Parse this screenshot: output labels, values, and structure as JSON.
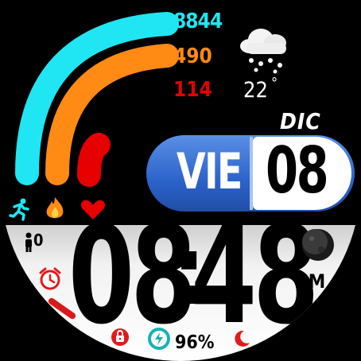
{
  "stats": {
    "steps": "8844",
    "calories": "490",
    "heart_rate": "114"
  },
  "weather": {
    "temperature": "22",
    "degree_symbol": "°"
  },
  "date": {
    "month": "DIC",
    "weekday": "VIE",
    "day": "08"
  },
  "time": {
    "hours": "08",
    "separator": ":",
    "minutes": "48",
    "ampm": "AM"
  },
  "floors": {
    "value": "0"
  },
  "battery": {
    "percent": "96%"
  },
  "colors": {
    "steps": "#1fe6f2",
    "calories": "#ff8a14",
    "heart": "#e60000",
    "date_pill": "#2c63c9"
  },
  "icons": [
    "running-icon",
    "flame-icon",
    "heart-icon",
    "weather-cloud-snow-icon",
    "person-icon",
    "alarm-icon",
    "moon-phase-icon",
    "lock-icon",
    "battery-icon",
    "night-moon-icon"
  ]
}
